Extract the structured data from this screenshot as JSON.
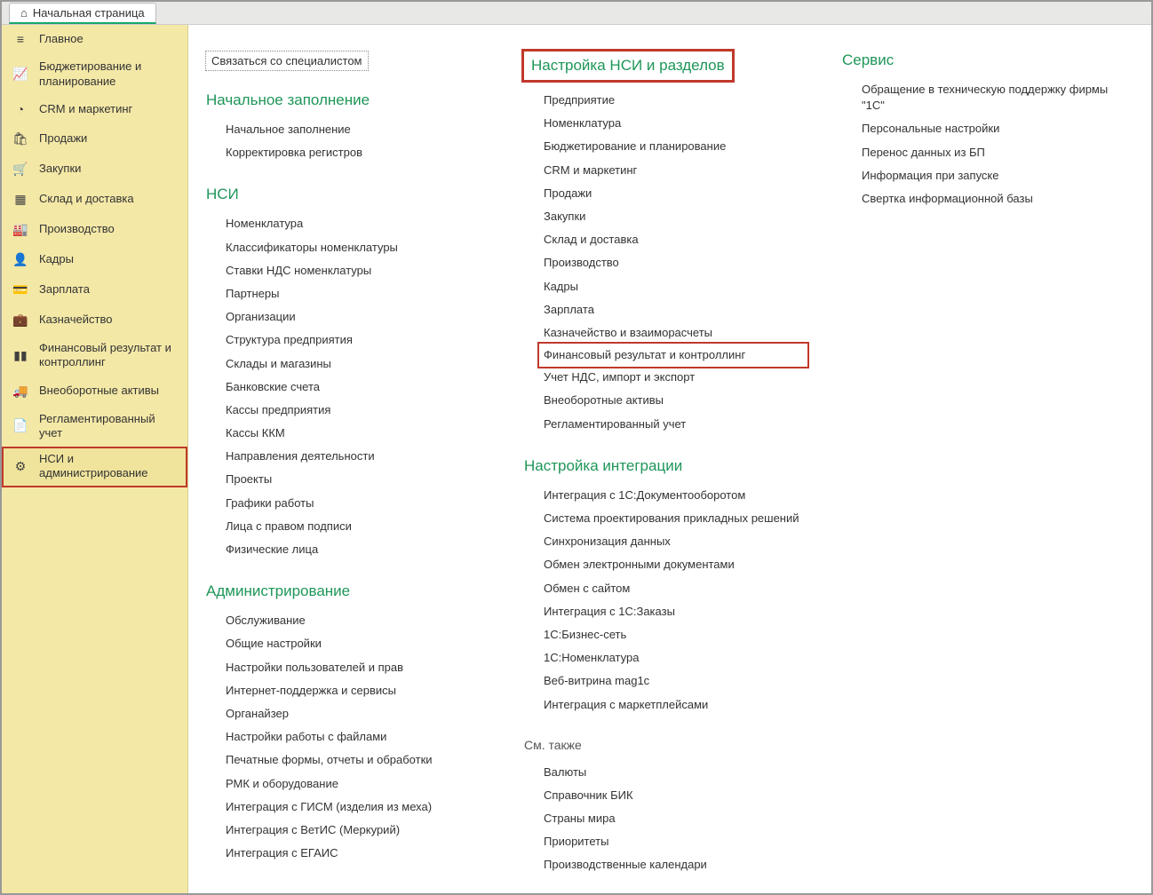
{
  "tab": {
    "label": "Начальная страница"
  },
  "sidebar": {
    "items": [
      {
        "icon": "≡",
        "label": "Главное"
      },
      {
        "icon": "📈",
        "label": "Бюджетирование и планирование"
      },
      {
        "icon": "◔",
        "label": "CRM и маркетинг"
      },
      {
        "icon": "🛍",
        "label": "Продажи"
      },
      {
        "icon": "🛒",
        "label": "Закупки"
      },
      {
        "icon": "▦",
        "label": "Склад и доставка"
      },
      {
        "icon": "🏭",
        "label": "Производство"
      },
      {
        "icon": "👤",
        "label": "Кадры"
      },
      {
        "icon": "💳",
        "label": "Зарплата"
      },
      {
        "icon": "💼",
        "label": "Казначейство"
      },
      {
        "icon": "▮▮",
        "label": "Финансовый результат и контроллинг"
      },
      {
        "icon": "🚚",
        "label": "Внеоборотные активы"
      },
      {
        "icon": "📄",
        "label": "Регламентированный учет"
      },
      {
        "icon": "⚙",
        "label": "НСИ и администрирование"
      }
    ]
  },
  "contact_link": "Связаться со специалистом",
  "col1": {
    "sections": [
      {
        "title": "Начальное заполнение",
        "items": [
          "Начальное заполнение",
          "Корректировка регистров"
        ]
      },
      {
        "title": "НСИ",
        "items": [
          "Номенклатура",
          "Классификаторы номенклатуры",
          "Ставки НДС номенклатуры",
          "Партнеры",
          "Организации",
          "Структура предприятия",
          "Склады и магазины",
          "Банковские счета",
          "Кассы предприятия",
          "Кассы ККМ",
          "Направления деятельности",
          "Проекты",
          "Графики работы",
          "Лица с правом подписи",
          "Физические лица"
        ]
      },
      {
        "title": "Администрирование",
        "items": [
          "Обслуживание",
          "Общие настройки",
          "Настройки пользователей и прав",
          "Интернет-поддержка и сервисы",
          "Органайзер",
          "Настройки работы с файлами",
          "Печатные формы, отчеты и обработки",
          "РМК и оборудование",
          "Интеграция с ГИСМ (изделия из меха)",
          "Интеграция с ВетИС (Меркурий)",
          "Интеграция с ЕГАИС"
        ]
      }
    ]
  },
  "col2": {
    "sections": [
      {
        "title": "Настройка НСИ и разделов",
        "title_highlighted": true,
        "items": [
          "Предприятие",
          "Номенклатура",
          "Бюджетирование и планирование",
          "CRM и маркетинг",
          "Продажи",
          "Закупки",
          "Склад и доставка",
          "Производство",
          "Кадры",
          "Зарплата",
          "Казначейство и взаиморасчеты",
          "Финансовый результат и контроллинг",
          "Учет НДС, импорт и экспорт",
          "Внеоборотные активы",
          "Регламентированный учет"
        ],
        "highlighted_index": 11
      },
      {
        "title": "Настройка интеграции",
        "items": [
          "Интеграция с 1С:Документооборотом",
          "Система проектирования прикладных решений",
          "Синхронизация данных",
          "Обмен электронными документами",
          "Обмен с сайтом",
          "Интеграция с 1С:Заказы",
          "1С:Бизнес-сеть",
          "1С:Номенклатура",
          "Веб-витрина mag1c",
          "Интеграция с маркетплейсами"
        ]
      },
      {
        "title": "См. также",
        "title_small": true,
        "items": [
          "Валюты",
          "Справочник БИК",
          "Страны мира",
          "Приоритеты",
          "Производственные календари"
        ]
      }
    ]
  },
  "col3": {
    "sections": [
      {
        "title": "Сервис",
        "items": [
          "Обращение в техническую поддержку фирмы \"1С\"",
          "Персональные настройки",
          "Перенос данных из БП",
          "Информация при запуске",
          "Свертка информационной базы"
        ]
      }
    ]
  }
}
